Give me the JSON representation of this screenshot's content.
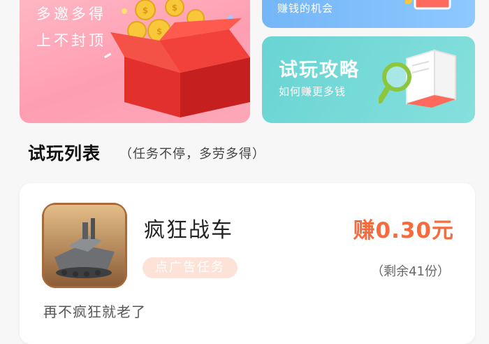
{
  "banners": {
    "invite": {
      "line1": "多邀多得",
      "line2": "上不封顶"
    },
    "earn": {
      "subtitle": "赚钱的机会"
    },
    "guide": {
      "title": "试玩攻略",
      "subtitle": "如何赚更多钱"
    }
  },
  "section": {
    "title": "试玩列表",
    "subtitle": "（任务不停，多劳多得）"
  },
  "games": [
    {
      "name": "疯狂战车",
      "tag": "点广告任务",
      "reward": "赚0.30元",
      "remaining": "（剩余41份）",
      "description": "再不疯狂就老了"
    }
  ],
  "colors": {
    "invite_bg": "#ff9eb2",
    "earn_bg": "#80bdfb",
    "guide_bg": "#72d8d6",
    "reward": "#f36b3e",
    "tag_bg": "#fde3d7"
  }
}
